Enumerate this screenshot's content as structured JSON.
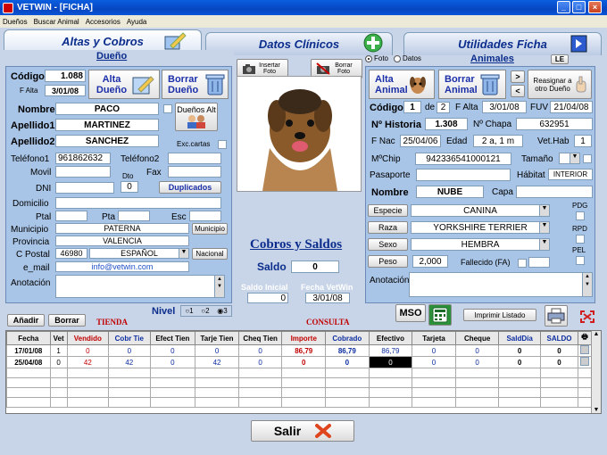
{
  "window": {
    "title": "VETWIN - [FICHA]"
  },
  "menu": [
    "Dueños",
    "Buscar Animal",
    "Accesorios",
    "Ayuda"
  ],
  "tabs": [
    "Altas y Cobros",
    "Datos Clínicos",
    "Utilidades Ficha",
    "LE"
  ],
  "owner": {
    "section_title": "Dueño",
    "codigo_label": "Código",
    "codigo": "1.088",
    "falta_label": "F Alta",
    "falta": "3/01/08",
    "alta_btn": "Alta Dueño",
    "borrar_btn": "Borrar Dueño",
    "nombre_label": "Nombre",
    "nombre": "PACO",
    "apellido1_label": "Apellido1",
    "apellido1": "MARTINEZ",
    "apellido2_label": "Apellido2",
    "apellido2": "SANCHEZ",
    "duenos_alt_btn": "Dueños Alt",
    "exc_cartas_label": "Exc.cartas",
    "telefono1_label": "Teléfono1",
    "telefono1": "961862632",
    "telefono2_label": "Teléfono2",
    "telefono2": "",
    "movil_label": "Movil",
    "movil": "",
    "fax_label": "Fax",
    "fax": "",
    "dto_label": "Dto",
    "dto": "0",
    "dni_label": "DNI",
    "dni": "",
    "duplicados_btn": "Duplicados",
    "domicilio_label": "Domicilio",
    "domicilio": "",
    "ptal_label": "Ptal",
    "pta_label": "Pta",
    "esc_label": "Esc",
    "municipio_label": "Municipio",
    "municipio": "PATERNA",
    "municipio_btn": "Municipio",
    "provincia_label": "Provincia",
    "provincia": "VALENCIA",
    "cpostal_label": "C Postal",
    "cpostal": "46980",
    "pais": "ESPAÑOL",
    "nacional_btn": "Nacional",
    "email_label": "e_mail",
    "email": "info@vetwin.com",
    "anotacion_label": "Anotación"
  },
  "photo": {
    "insertar_btn": "Insertar Foto",
    "borrar_btn": "Borrar Foto"
  },
  "cobros": {
    "title": "Cobros y Saldos",
    "saldo_label": "Saldo",
    "saldo": "0",
    "saldo_inicial_label": "Saldo Inicial",
    "saldo_inicial": "0",
    "fecha_vetwin_label": "Fecha VetWin",
    "fecha_vetwin": "3/01/08"
  },
  "animal": {
    "radio_foto": "Foto",
    "radio_datos": "Datos",
    "section_title": "Animales",
    "alta_btn": "Alta Animal",
    "borrar_btn": "Borrar Animal",
    "reasignar_btn": "Reasignar a otro Dueño",
    "codigo_label": "Código",
    "codigo": "1",
    "de_label": "de",
    "de": "2",
    "falta_label": "F Alta",
    "falta": "3/01/08",
    "fuv_label": "FUV",
    "fuv": "21/04/08",
    "historia_label": "Nº Historia",
    "historia": "1.308",
    "chapa_label": "Nº Chapa",
    "chapa": "632951",
    "fnac_label": "F Nac",
    "fnac": "25/04/06",
    "edad_label": "Edad",
    "edad": "2 a, 1 m",
    "vethab_label": "Vet.Hab",
    "vethab": "1",
    "chip_label": "MºChip",
    "chip": "942336541000121",
    "tamano_label": "Tamaño",
    "pasaporte_label": "Pasaporte",
    "pasaporte": "",
    "habitat_label": "Hábitat",
    "habitat": "INTERIOR",
    "nombre_label": "Nombre",
    "nombre": "NUBE",
    "capa_label": "Capa",
    "capa": "",
    "especie_btn": "Especie",
    "especie": "CANINA",
    "raza_btn": "Raza",
    "raza": "YORKSHIRE TERRIER",
    "sexo_btn": "Sexo",
    "sexo": "HEMBRA",
    "peso_btn": "Peso",
    "peso": "2,000",
    "fallecido_label": "Fallecido (FA)",
    "pdg": "PDG",
    "rpd": "RPD",
    "pel": "PEL",
    "anotacion_label": "Anotación"
  },
  "toolbar": {
    "nivel_label": "Nivel",
    "nivel_options": [
      "1",
      "2",
      "3"
    ],
    "anadir_btn": "Añadir",
    "borrar_btn": "Borrar",
    "tienda_label": "TIENDA",
    "consulta_label": "CONSULTA",
    "mso_btn": "MSO",
    "imprimir_btn": "Imprimir Listado"
  },
  "table": {
    "headers": [
      "Fecha",
      "Vet",
      "Vendido",
      "Cobr Tie",
      "Efect Tien",
      "Tarje Tien",
      "Cheq Tien",
      "Importe",
      "Cobrado",
      "Efectivo",
      "Tarjeta",
      "Cheque",
      "SaldDía",
      "SALDO"
    ],
    "rows": [
      [
        "17/01/08",
        "1",
        "0",
        "0",
        "0",
        "0",
        "0",
        "86,79",
        "86,79",
        "86,79",
        "0",
        "0",
        "0",
        "0"
      ],
      [
        "25/04/08",
        "0",
        "42",
        "42",
        "0",
        "42",
        "0",
        "0",
        "0",
        "0",
        "0",
        "0",
        "0",
        "0"
      ]
    ]
  },
  "salir_btn": "Salir"
}
